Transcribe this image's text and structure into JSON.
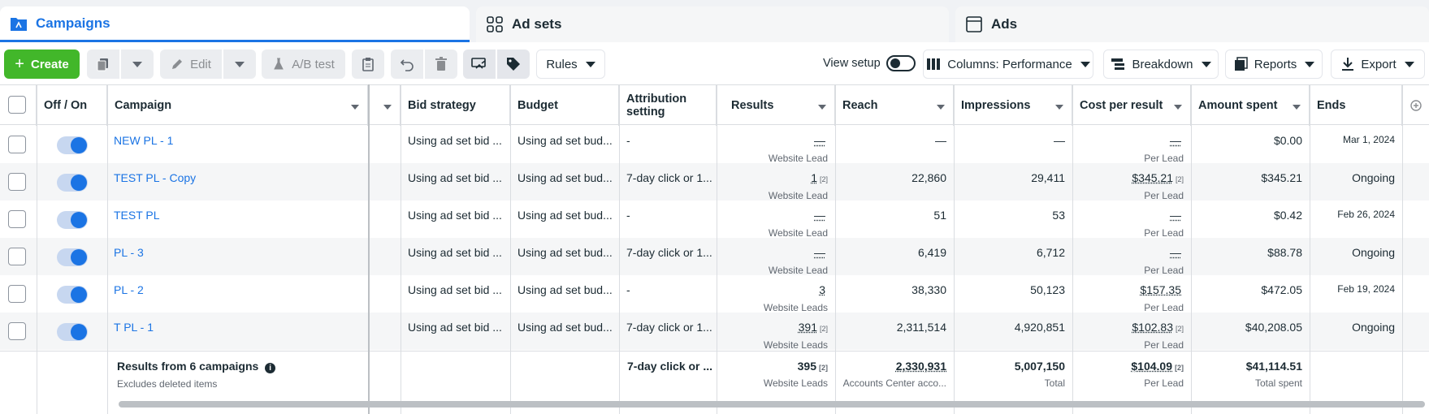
{
  "tabs": {
    "campaigns": "Campaigns",
    "adsets": "Ad sets",
    "ads": "Ads"
  },
  "toolbar": {
    "create": "Create",
    "edit": "Edit",
    "ab_test": "A/B test",
    "rules": "Rules",
    "view_setup": "View setup",
    "columns": "Columns: Performance",
    "breakdown": "Breakdown",
    "reports": "Reports",
    "export": "Export"
  },
  "headers": {
    "off_on": "Off / On",
    "campaign": "Campaign",
    "bid_strategy": "Bid strategy",
    "budget": "Budget",
    "attribution": "Attribution setting",
    "results": "Results",
    "reach": "Reach",
    "impressions": "Impressions",
    "cost_per_result": "Cost per result",
    "amount_spent": "Amount spent",
    "ends": "Ends"
  },
  "rows": [
    {
      "name": "NEW PL - 1",
      "bid": "Using ad set bid ...",
      "budget": "Using ad set bud...",
      "attr": "-",
      "results": "—",
      "results_sup": "",
      "results_sub": "Website Lead",
      "reach": "—",
      "impr": "—",
      "cpr": "—",
      "cpr_sup": "",
      "cpr_sub": "Per Lead",
      "spent": "$0.00",
      "ends": "Mar 1, 2024"
    },
    {
      "name": "TEST PL - Copy",
      "bid": "Using ad set bid ...",
      "budget": "Using ad set bud...",
      "attr": "7-day click or 1...",
      "results": "1",
      "results_sup": "[2]",
      "results_sub": "Website Lead",
      "reach": "22,860",
      "impr": "29,411",
      "cpr": "$345.21",
      "cpr_sup": "[2]",
      "cpr_sub": "Per Lead",
      "spent": "$345.21",
      "ends": "Ongoing"
    },
    {
      "name": "TEST PL",
      "bid": "Using ad set bid ...",
      "budget": "Using ad set bud...",
      "attr": "-",
      "results": "—",
      "results_sup": "",
      "results_sub": "Website Lead",
      "reach": "51",
      "impr": "53",
      "cpr": "—",
      "cpr_sup": "",
      "cpr_sub": "Per Lead",
      "spent": "$0.42",
      "ends": "Feb 26, 2024"
    },
    {
      "name": "PL - 3",
      "bid": "Using ad set bid ...",
      "budget": "Using ad set bud...",
      "attr": "7-day click or 1...",
      "results": "—",
      "results_sup": "",
      "results_sub": "Website Lead",
      "reach": "6,419",
      "impr": "6,712",
      "cpr": "—",
      "cpr_sup": "",
      "cpr_sub": "Per Lead",
      "spent": "$88.78",
      "ends": "Ongoing"
    },
    {
      "name": "PL - 2",
      "bid": "Using ad set bid ...",
      "budget": "Using ad set bud...",
      "attr": "-",
      "results": "3",
      "results_sup": "",
      "results_sub": "Website Leads",
      "reach": "38,330",
      "impr": "50,123",
      "cpr": "$157.35",
      "cpr_sup": "",
      "cpr_sub": "Per Lead",
      "spent": "$472.05",
      "ends": "Feb 19, 2024"
    },
    {
      "name": "T PL - 1",
      "bid": "Using ad set bid ...",
      "budget": "Using ad set bud...",
      "attr": "7-day click or 1...",
      "results": "391",
      "results_sup": "[2]",
      "results_sub": "Website Leads",
      "reach": "2,311,514",
      "impr": "4,920,851",
      "cpr": "$102.83",
      "cpr_sup": "[2]",
      "cpr_sub": "Per Lead",
      "spent": "$40,208.05",
      "ends": "Ongoing"
    }
  ],
  "totals": {
    "label": "Results from 6 campaigns",
    "note": "Excludes deleted items",
    "attr": "7-day click or ...",
    "results": "395",
    "results_sup": "[2]",
    "results_sub": "Website Leads",
    "reach": "2,330,931",
    "reach_sub": "Accounts Center acco...",
    "impr": "5,007,150",
    "impr_sub": "Total",
    "cpr": "$104.09",
    "cpr_sup": "[2]",
    "cpr_sub": "Per Lead",
    "spent": "$41,114.51",
    "spent_sub": "Total spent"
  },
  "colors": {
    "accent": "#1b74e4",
    "create": "#42b72a"
  }
}
